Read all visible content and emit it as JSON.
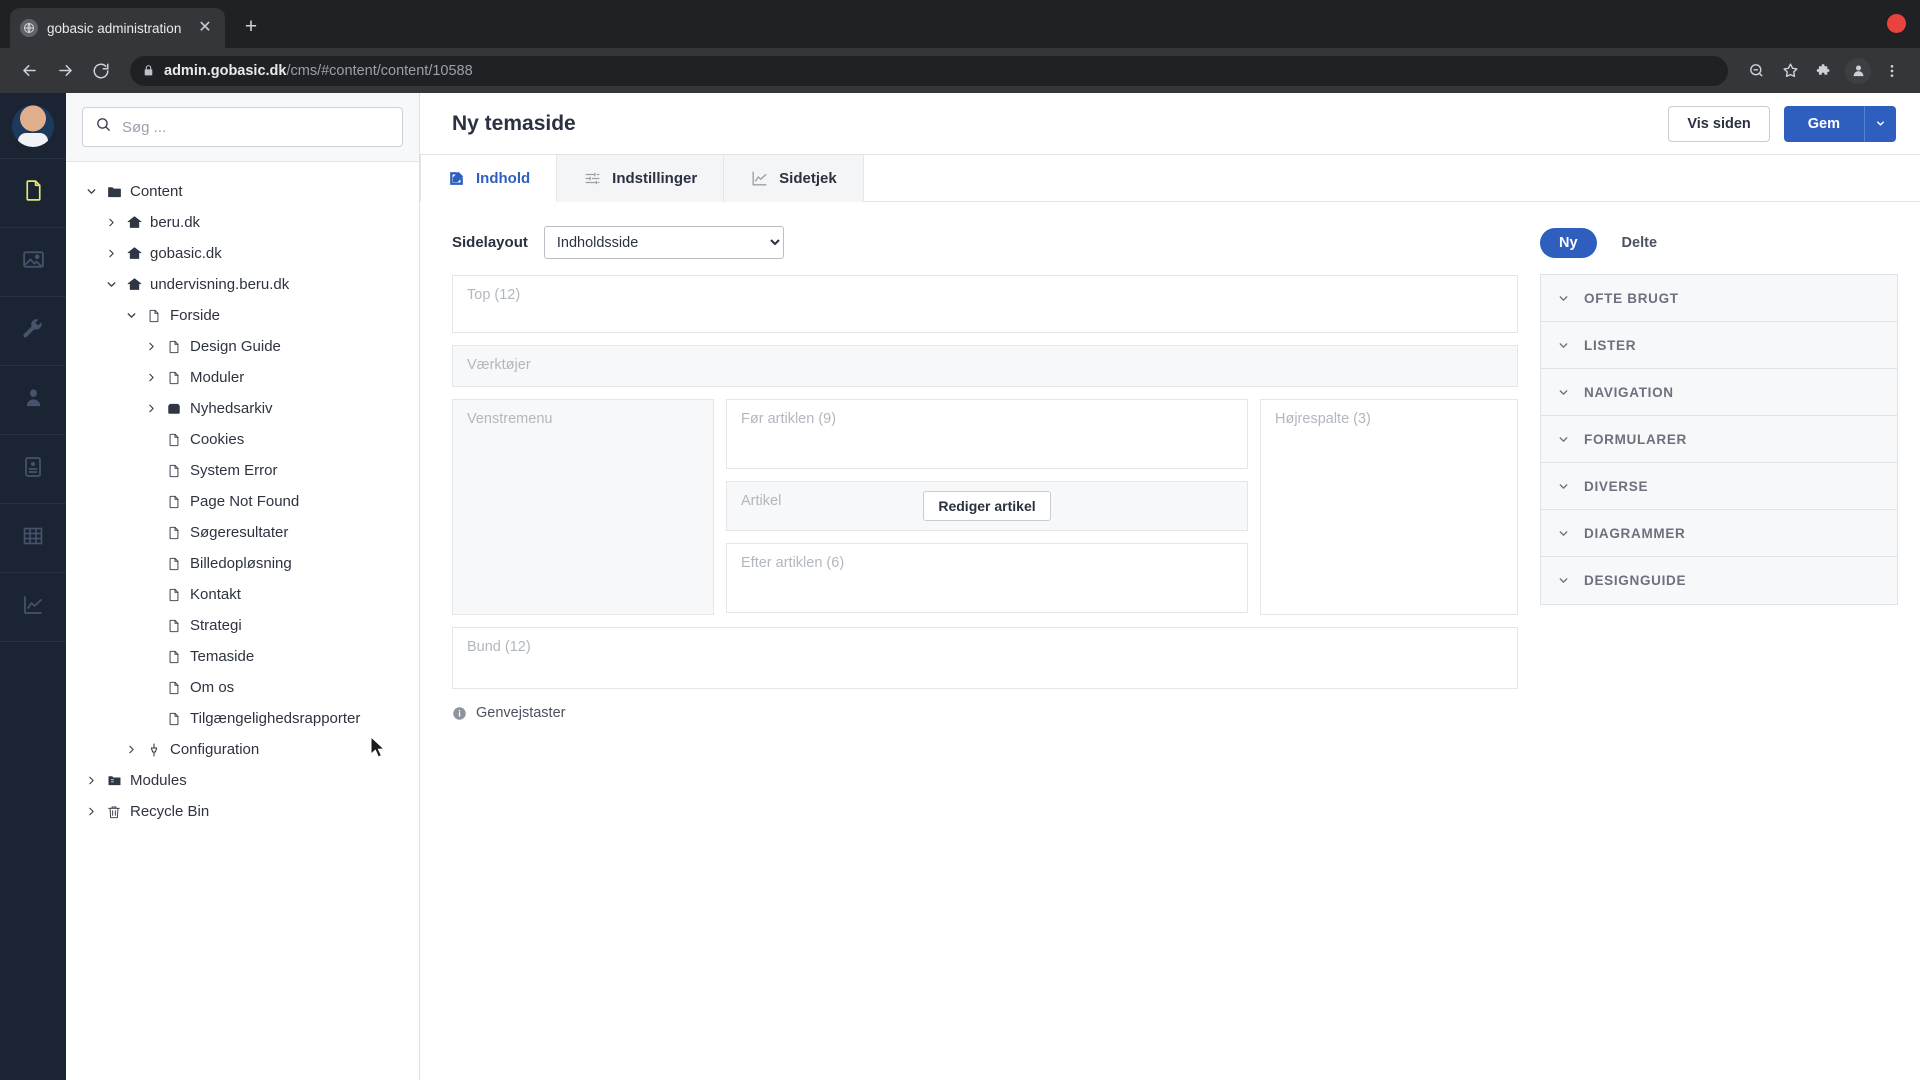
{
  "browser": {
    "tab_title": "gobasic administration",
    "favicon": "globe-icon",
    "close_label": "✕",
    "newtab_label": "+",
    "url_domain": "admin.gobasic.dk",
    "url_path": "/cms/#content/content/10588",
    "back_icon": "back-arrow-icon",
    "forward_icon": "forward-arrow-icon",
    "reload_icon": "reload-icon",
    "lock_icon": "lock-icon",
    "zoom_icon": "zoom-icon",
    "bookmark_icon": "star-icon",
    "extensions_icon": "puzzle-icon",
    "profile_icon": "profile-icon",
    "menu_icon": "kebab-menu-icon"
  },
  "rail": {
    "avatar": "user-avatar",
    "items": [
      {
        "name": "content-icon",
        "active": true
      },
      {
        "name": "media-icon",
        "active": false
      },
      {
        "name": "settings-wrench-icon",
        "active": false
      },
      {
        "name": "users-icon",
        "active": false
      },
      {
        "name": "forms-icon",
        "active": false
      },
      {
        "name": "tables-icon",
        "active": false
      },
      {
        "name": "analytics-icon",
        "active": false
      }
    ]
  },
  "sidebar": {
    "search_placeholder": "Søg ...",
    "search_value": "",
    "tree": [
      {
        "label": "Content",
        "indent": 0,
        "chevron": "down",
        "icon": "folder-icon"
      },
      {
        "label": "beru.dk",
        "indent": 1,
        "chevron": "right",
        "icon": "home-icon"
      },
      {
        "label": "gobasic.dk",
        "indent": 1,
        "chevron": "right",
        "icon": "home-icon"
      },
      {
        "label": "undervisning.beru.dk",
        "indent": 1,
        "chevron": "down",
        "icon": "home-icon"
      },
      {
        "label": "Forside",
        "indent": 2,
        "chevron": "down",
        "icon": "document-icon"
      },
      {
        "label": "Design Guide",
        "indent": 3,
        "chevron": "right",
        "icon": "document-icon"
      },
      {
        "label": "Moduler",
        "indent": 3,
        "chevron": "right",
        "icon": "document-icon"
      },
      {
        "label": "Nyhedsarkiv",
        "indent": 3,
        "chevron": "right",
        "icon": "archive-icon"
      },
      {
        "label": "Cookies",
        "indent": 3,
        "chevron": "none",
        "icon": "document-icon"
      },
      {
        "label": "System Error",
        "indent": 3,
        "chevron": "none",
        "icon": "document-icon"
      },
      {
        "label": "Page Not Found",
        "indent": 3,
        "chevron": "none",
        "icon": "document-icon"
      },
      {
        "label": "Søgeresultater",
        "indent": 3,
        "chevron": "none",
        "icon": "document-icon"
      },
      {
        "label": "Billedopløsning",
        "indent": 3,
        "chevron": "none",
        "icon": "document-icon"
      },
      {
        "label": "Kontakt",
        "indent": 3,
        "chevron": "none",
        "icon": "document-icon"
      },
      {
        "label": "Strategi",
        "indent": 3,
        "chevron": "none",
        "icon": "document-icon"
      },
      {
        "label": "Temaside",
        "indent": 3,
        "chevron": "none",
        "icon": "document-icon"
      },
      {
        "label": "Om os",
        "indent": 3,
        "chevron": "none",
        "icon": "document-icon"
      },
      {
        "label": "Tilgængelighedsrapporter",
        "indent": 3,
        "chevron": "none",
        "icon": "document-icon"
      },
      {
        "label": "Configuration",
        "indent": 2,
        "chevron": "right",
        "icon": "config-icon"
      },
      {
        "label": "Modules",
        "indent": 0,
        "chevron": "right",
        "icon": "modules-icon"
      },
      {
        "label": "Recycle Bin",
        "indent": 0,
        "chevron": "right",
        "icon": "trash-icon"
      }
    ]
  },
  "header": {
    "title": "Ny temaside",
    "view_page_label": "Vis siden",
    "save_label": "Gem",
    "save_caret_icon": "chevron-down-icon"
  },
  "tabs": [
    {
      "label": "Indhold",
      "icon": "edit-icon",
      "active": true
    },
    {
      "label": "Indstillinger",
      "icon": "sliders-icon",
      "active": false
    },
    {
      "label": "Sidetjek",
      "icon": "chart-line-icon",
      "active": false
    }
  ],
  "editor": {
    "layout_label": "Sidelayout",
    "layout_value": "Indholdsside",
    "layout_options": [
      "Indholdsside"
    ],
    "zones": {
      "top": "Top (12)",
      "tools": "Værktøjer",
      "leftmenu": "Venstremenu",
      "before_article": "Før artiklen (9)",
      "article": "Artikel",
      "edit_article_button": "Rediger artikel",
      "after_article": "Efter artiklen (6)",
      "right_column": "Højrespalte (3)",
      "bottom": "Bund (12)"
    },
    "shortcuts_label": "Genvejstaster",
    "shortcuts_icon": "info-icon"
  },
  "right_panel": {
    "toggle_new": "Ny",
    "toggle_shared": "Delte",
    "groups": [
      "OFTE BRUGT",
      "LISTER",
      "NAVIGATION",
      "FORMULARER",
      "DIVERSE",
      "DIAGRAMMER",
      "DESIGNGUIDE"
    ]
  },
  "colors": {
    "primary": "#2f5fbe",
    "rail_bg": "#1b2433",
    "rail_active": "#e3e86a",
    "chrome_bg": "#202124"
  }
}
